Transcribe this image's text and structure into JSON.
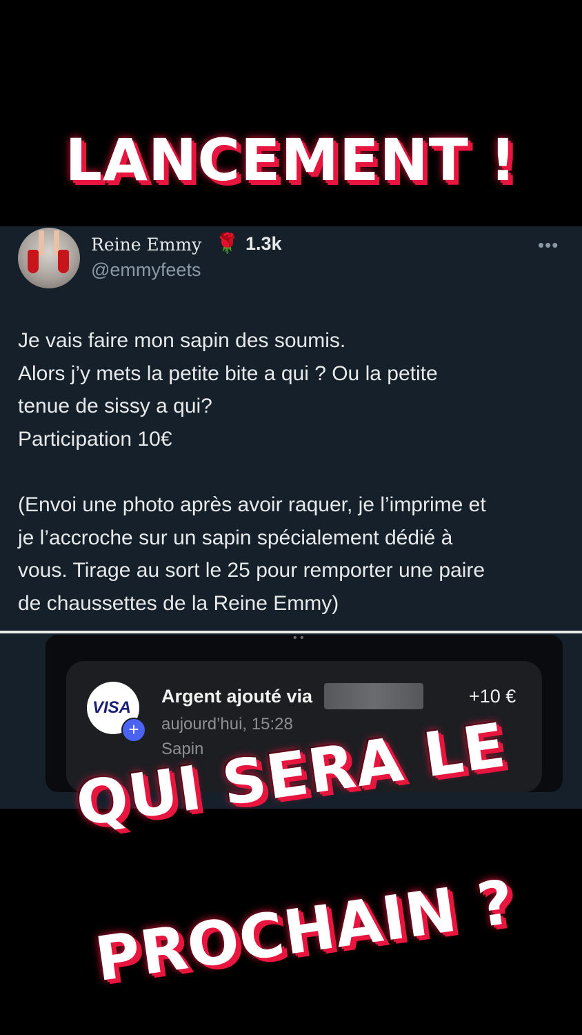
{
  "overlay": {
    "headline_top": "LANCEMENT !",
    "headline_bottom_1": "QUI SERA LE",
    "headline_bottom_2": "PROCHAIN ?"
  },
  "tweet": {
    "author_name": "Reine Emmy",
    "author_emoji": "🌹",
    "followers": "1.3k",
    "handle": "@emmyfeets",
    "more_icon": "more-horizontal-icon",
    "lines": [
      "Je vais faire mon sapin des soumis.",
      "Alors j’y mets la petite bite a qui ? Ou la petite",
      "tenue de sissy a qui?",
      "Participation 10€"
    ],
    "lines_2": [
      "(Envoi une photo après avoir raquer, je l’imprime et",
      "je l’accroche sur un sapin spécialement dédié à",
      "vous. Tirage au sort le 25 pour remporter une paire",
      "de chaussettes de la Reine Emmy)"
    ]
  },
  "transaction": {
    "card_brand": "VISA",
    "badge_symbol": "+",
    "title": "Argent ajouté via",
    "amount": "+10 €",
    "date": "aujourd’hui, 15:28",
    "category": "Sapin"
  },
  "colors": {
    "accent": "#e8163e",
    "tweet_bg": "#15202b",
    "card_bg": "#1c1e22"
  }
}
